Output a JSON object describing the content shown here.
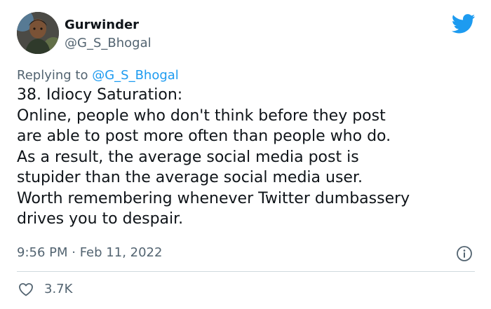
{
  "author": {
    "display_name": "Gurwinder",
    "handle": "@G_S_Bhogal"
  },
  "reply": {
    "prefix": "Replying to ",
    "handle": "@G_S_Bhogal"
  },
  "tweet": {
    "lines": [
      "38. Idiocy Saturation:",
      "Online, people who don't think before they post",
      "are able to post more often than people who do.",
      "As a result, the average social media post is",
      "stupider than the average social media user.",
      "Worth remembering whenever Twitter dumbassery",
      "drives you to despair."
    ],
    "timestamp": "9:56 PM · Feb 11, 2022"
  },
  "actions": {
    "like_count": "3.7K"
  },
  "icons": {
    "brand": "twitter-bird-icon",
    "info": "info-icon",
    "like": "heart-icon"
  },
  "colors": {
    "brand_blue": "#1d9bf0",
    "text_primary": "#0f1419",
    "text_secondary": "#536471",
    "divider": "#cfd9de"
  }
}
